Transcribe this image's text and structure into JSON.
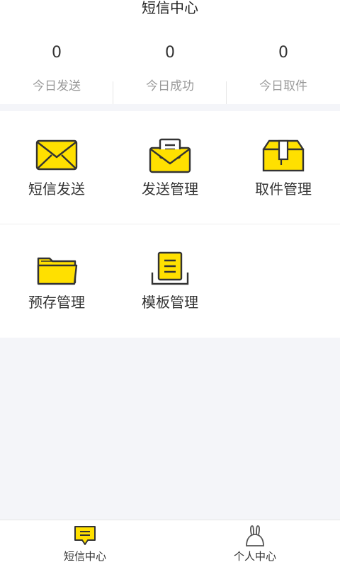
{
  "header": {
    "title": "短信中心"
  },
  "stats": [
    {
      "value": "0",
      "label": "今日发送"
    },
    {
      "value": "0",
      "label": "今日成功"
    },
    {
      "value": "0",
      "label": "今日取件"
    }
  ],
  "grid": [
    {
      "label": "短信发送",
      "icon": "envelope-icon"
    },
    {
      "label": "发送管理",
      "icon": "open-envelope-icon"
    },
    {
      "label": "取件管理",
      "icon": "package-box-icon"
    },
    {
      "label": "预存管理",
      "icon": "folder-icon"
    },
    {
      "label": "模板管理",
      "icon": "template-document-icon"
    }
  ],
  "tabs": [
    {
      "label": "短信中心",
      "icon": "message-icon"
    },
    {
      "label": "个人中心",
      "icon": "rabbit-icon"
    }
  ],
  "colors": {
    "accent": "#FFE000",
    "outline": "#333333"
  }
}
